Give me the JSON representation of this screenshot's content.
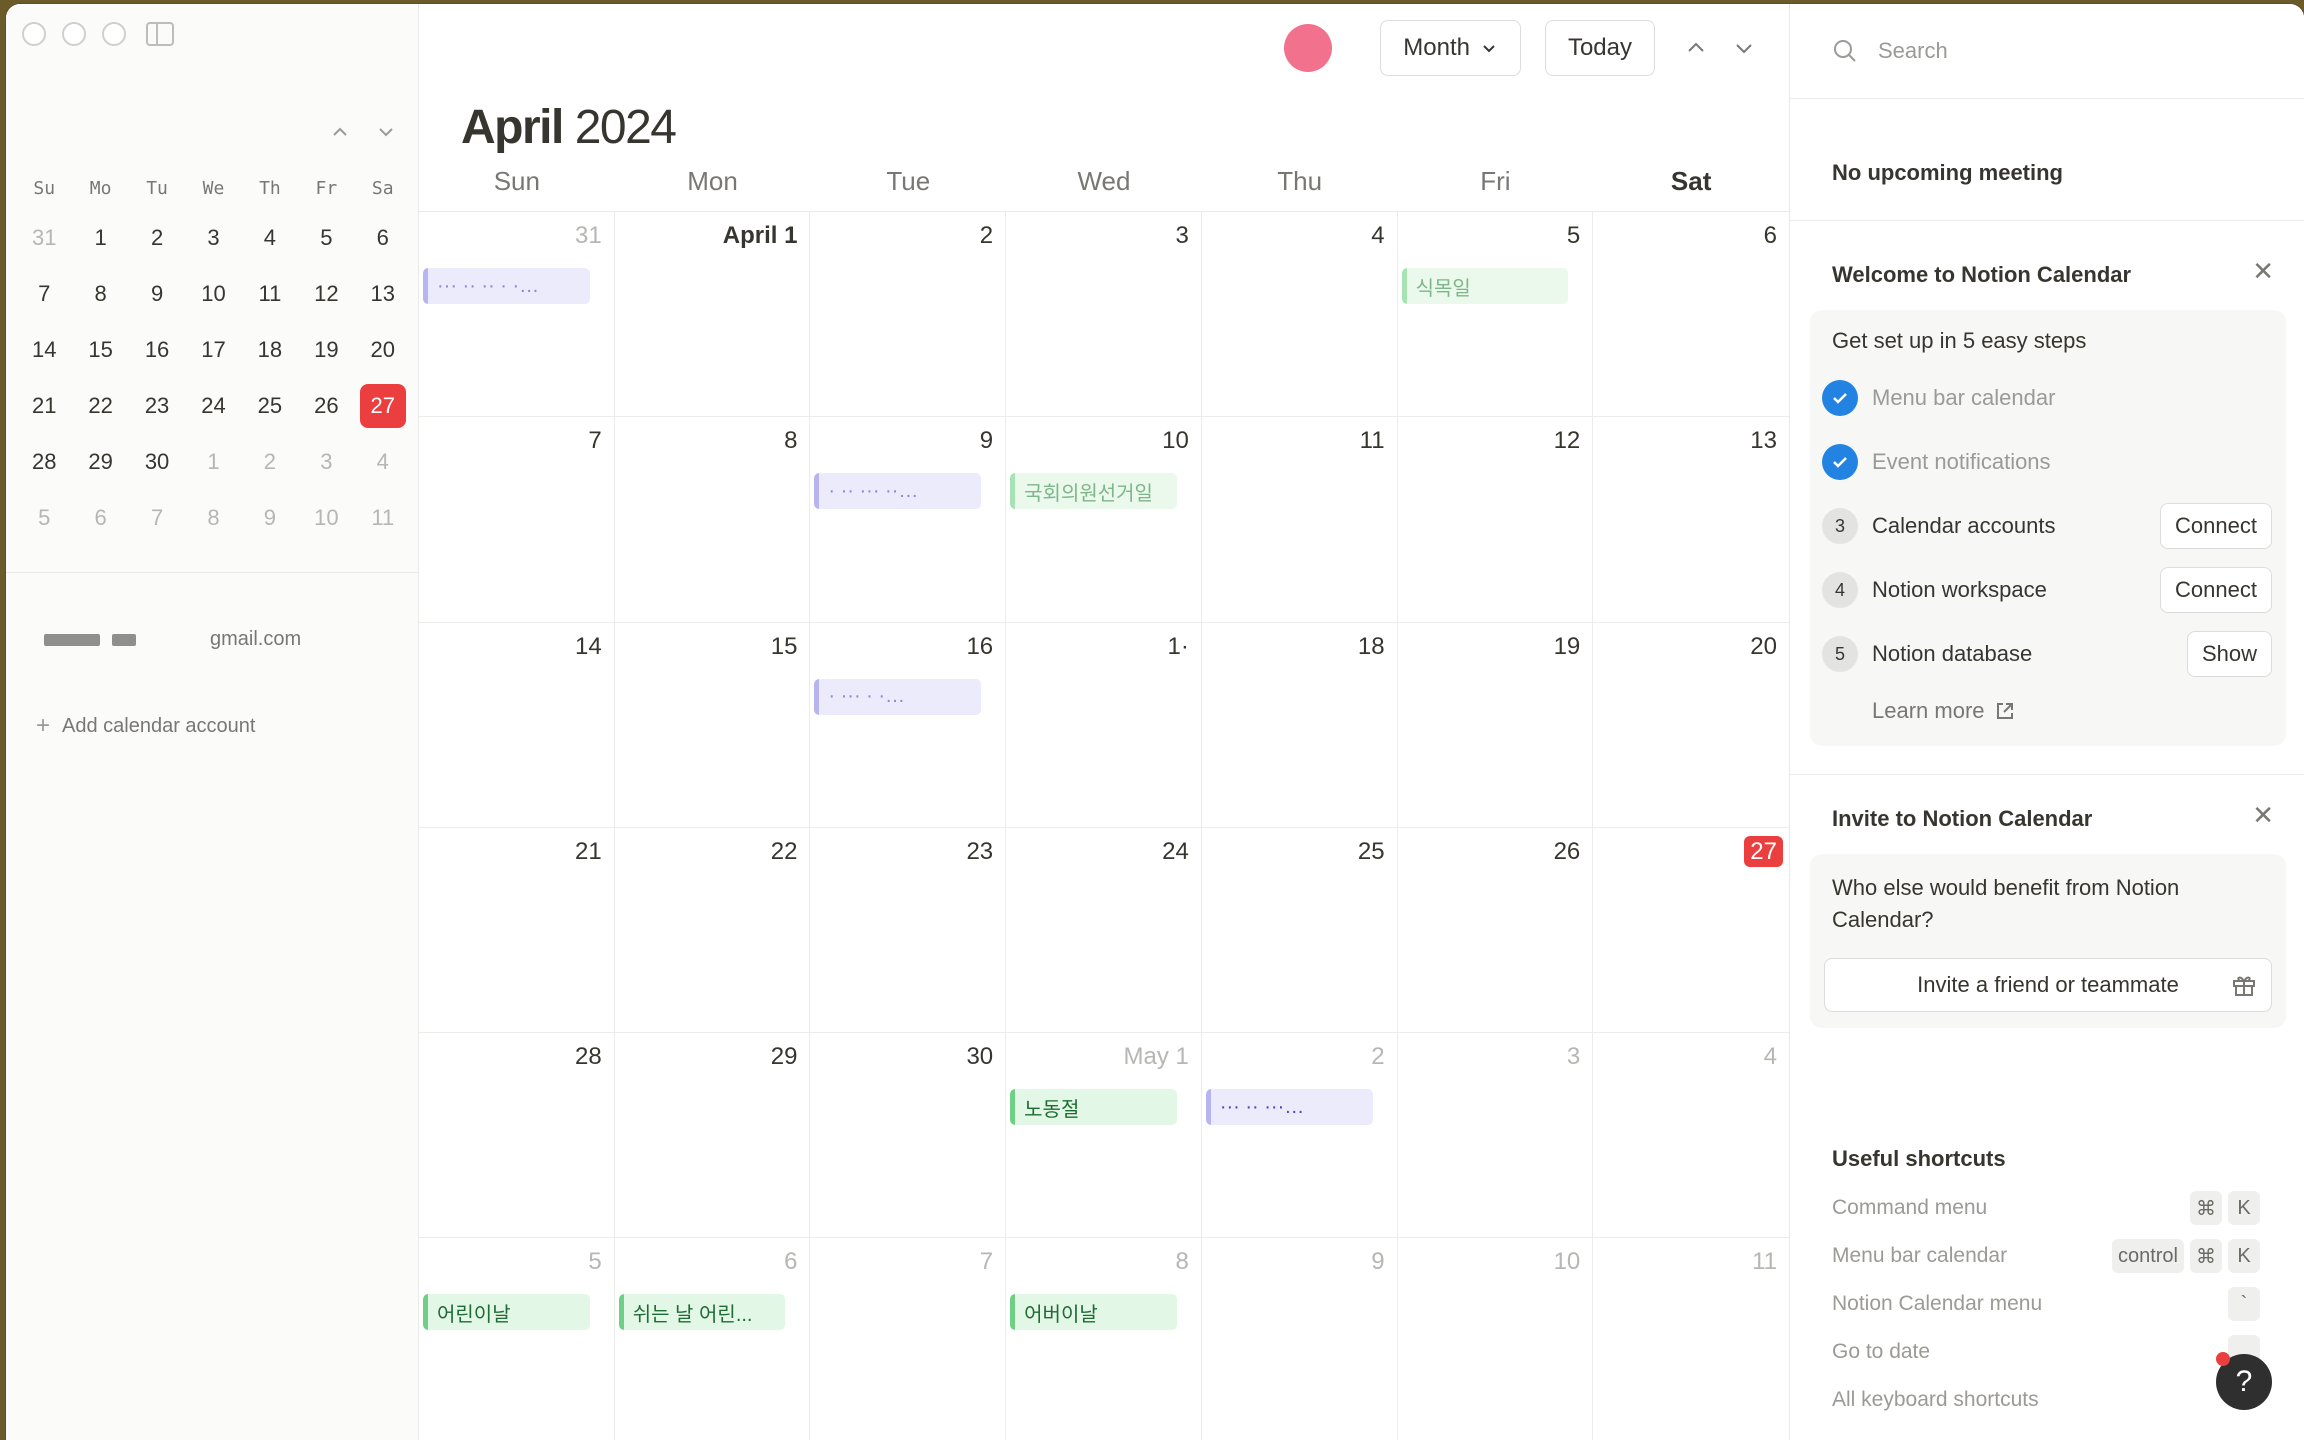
{
  "mini_calendar": {
    "weekdays": [
      "Su",
      "Mo",
      "Tu",
      "We",
      "Th",
      "Fr",
      "Sa"
    ],
    "weeks": [
      [
        {
          "d": "31",
          "dim": true
        },
        {
          "d": "1"
        },
        {
          "d": "2"
        },
        {
          "d": "3"
        },
        {
          "d": "4"
        },
        {
          "d": "5"
        },
        {
          "d": "6"
        }
      ],
      [
        {
          "d": "7"
        },
        {
          "d": "8"
        },
        {
          "d": "9"
        },
        {
          "d": "10"
        },
        {
          "d": "11"
        },
        {
          "d": "12"
        },
        {
          "d": "13"
        }
      ],
      [
        {
          "d": "14"
        },
        {
          "d": "15"
        },
        {
          "d": "16"
        },
        {
          "d": "17"
        },
        {
          "d": "18"
        },
        {
          "d": "19"
        },
        {
          "d": "20"
        }
      ],
      [
        {
          "d": "21"
        },
        {
          "d": "22"
        },
        {
          "d": "23"
        },
        {
          "d": "24"
        },
        {
          "d": "25"
        },
        {
          "d": "26"
        },
        {
          "d": "27",
          "today": true
        }
      ],
      [
        {
          "d": "28"
        },
        {
          "d": "29"
        },
        {
          "d": "30"
        },
        {
          "d": "1",
          "dim": true
        },
        {
          "d": "2",
          "dim": true
        },
        {
          "d": "3",
          "dim": true
        },
        {
          "d": "4",
          "dim": true
        }
      ],
      [
        {
          "d": "5",
          "dim": true
        },
        {
          "d": "6",
          "dim": true
        },
        {
          "d": "7",
          "dim": true
        },
        {
          "d": "8",
          "dim": true
        },
        {
          "d": "9",
          "dim": true
        },
        {
          "d": "10",
          "dim": true
        },
        {
          "d": "11",
          "dim": true
        }
      ]
    ]
  },
  "sidebar": {
    "account_email_suffix": "gmail.com",
    "add_account": "Add calendar account"
  },
  "toolbar": {
    "view_label": "Month",
    "today_label": "Today"
  },
  "main": {
    "month": "April",
    "year": "2024",
    "weekdays": [
      "Sun",
      "Mon",
      "Tue",
      "Wed",
      "Thu",
      "Fri",
      "Sat"
    ],
    "cells": [
      {
        "n": "31",
        "dim": true,
        "events": [
          {
            "t": "··· ·· ·· · ·…",
            "c": "purple"
          }
        ]
      },
      {
        "n": "April 1",
        "bold": true,
        "events": []
      },
      {
        "n": "2",
        "events": []
      },
      {
        "n": "3",
        "events": []
      },
      {
        "n": "4",
        "events": []
      },
      {
        "n": "5",
        "events": [
          {
            "t": "식목일",
            "c": "green faded"
          }
        ]
      },
      {
        "n": "6",
        "events": []
      },
      {
        "n": "7",
        "events": []
      },
      {
        "n": "8",
        "events": []
      },
      {
        "n": "9",
        "events": [
          {
            "t": "· ·· ··· ··…",
            "c": "purple"
          }
        ]
      },
      {
        "n": "10",
        "events": [
          {
            "t": "국회의원선거일",
            "c": "green faded"
          }
        ]
      },
      {
        "n": "11",
        "events": []
      },
      {
        "n": "12",
        "events": []
      },
      {
        "n": "13",
        "events": []
      },
      {
        "n": "14",
        "events": []
      },
      {
        "n": "15",
        "events": []
      },
      {
        "n": "16",
        "events": [
          {
            "t": "· ··· · ·…",
            "c": "purple"
          }
        ]
      },
      {
        "n": "1·",
        "events": []
      },
      {
        "n": "18",
        "events": []
      },
      {
        "n": "19",
        "events": []
      },
      {
        "n": "20",
        "events": []
      },
      {
        "n": "21",
        "events": []
      },
      {
        "n": "22",
        "events": []
      },
      {
        "n": "23",
        "events": []
      },
      {
        "n": "24",
        "events": []
      },
      {
        "n": "25",
        "events": []
      },
      {
        "n": "26",
        "events": []
      },
      {
        "n": "27",
        "today": true,
        "events": []
      },
      {
        "n": "28",
        "events": []
      },
      {
        "n": "29",
        "events": []
      },
      {
        "n": "30",
        "events": []
      },
      {
        "n": "May 1",
        "dim": true,
        "events": [
          {
            "t": "노동절",
            "c": "green"
          }
        ]
      },
      {
        "n": "2",
        "dim": true,
        "events": [
          {
            "t": "··· ·· ···…",
            "c": "purple strong"
          }
        ]
      },
      {
        "n": "3",
        "dim": true,
        "events": []
      },
      {
        "n": "4",
        "dim": true,
        "events": []
      },
      {
        "n": "5",
        "dim": true,
        "events": [
          {
            "t": "어린이날",
            "c": "green"
          }
        ]
      },
      {
        "n": "6",
        "dim": true,
        "events": [
          {
            "t": "쉬는 날 어린...",
            "c": "green"
          }
        ]
      },
      {
        "n": "7",
        "dim": true,
        "events": []
      },
      {
        "n": "8",
        "dim": true,
        "events": [
          {
            "t": "어버이날",
            "c": "green"
          }
        ]
      },
      {
        "n": "9",
        "dim": true,
        "events": []
      },
      {
        "n": "10",
        "dim": true,
        "events": []
      },
      {
        "n": "11",
        "dim": true,
        "events": []
      }
    ]
  },
  "panel": {
    "search_placeholder": "Search",
    "no_meeting": "No upcoming meeting",
    "welcome_title": "Welcome to Notion Calendar",
    "setup_heading": "Get set up in 5 easy steps",
    "steps": [
      {
        "num": "1",
        "label": "Menu bar calendar",
        "done": true,
        "action": ""
      },
      {
        "num": "2",
        "label": "Event notifications",
        "done": true,
        "action": ""
      },
      {
        "num": "3",
        "label": "Calendar accounts",
        "done": false,
        "action": "Connect"
      },
      {
        "num": "4",
        "label": "Notion workspace",
        "done": false,
        "action": "Connect"
      },
      {
        "num": "5",
        "label": "Notion database",
        "done": false,
        "action": "Show"
      }
    ],
    "learn_more": "Learn more",
    "invite_title": "Invite to Notion Calendar",
    "invite_text": "Who else would benefit from Notion Calendar?",
    "invite_button": "Invite a friend or teammate",
    "shortcuts_title": "Useful shortcuts",
    "shortcuts": [
      {
        "label": "Command menu",
        "keys": [
          "⌘",
          "K"
        ]
      },
      {
        "label": "Menu bar calendar",
        "keys": [
          "control",
          "⌘",
          "K"
        ]
      },
      {
        "label": "Notion Calendar menu",
        "keys": [
          "`"
        ]
      },
      {
        "label": "Go to date",
        "keys": [
          ""
        ]
      },
      {
        "label": "All keyboard shortcuts",
        "keys": []
      }
    ],
    "help_label": "?"
  },
  "colors": {
    "today_red": "#eb3f3f",
    "check_blue": "#2383e2",
    "avatar_pink": "#f2718c"
  }
}
